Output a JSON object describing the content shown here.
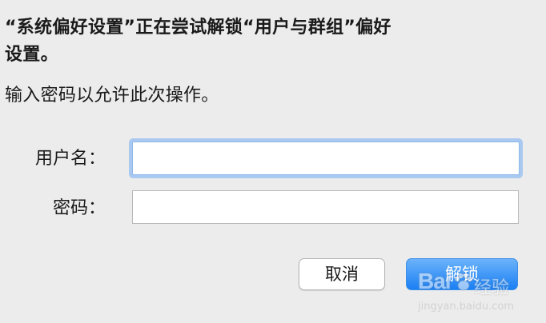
{
  "dialog": {
    "title_line1": "“系统偏好设置”正在尝试解锁“用户与群组”偏好",
    "title_line2": "设置。",
    "message": "输入密码以允许此次操作。",
    "username_label": "用户名：",
    "username_value": "",
    "password_label": "密码：",
    "password_value": "",
    "cancel_label": "取消",
    "unlock_label": "解锁"
  },
  "watermark": {
    "logo": "Bai",
    "word": "经验",
    "url": "jingyan.baidu.com"
  },
  "colors": {
    "background": "#ececec",
    "focus_ring": "#a9c9f1",
    "unlock_button_top": "#6cb3fa",
    "unlock_button_bottom": "#1a7ff3"
  },
  "icons": [
    "paw-icon"
  ]
}
